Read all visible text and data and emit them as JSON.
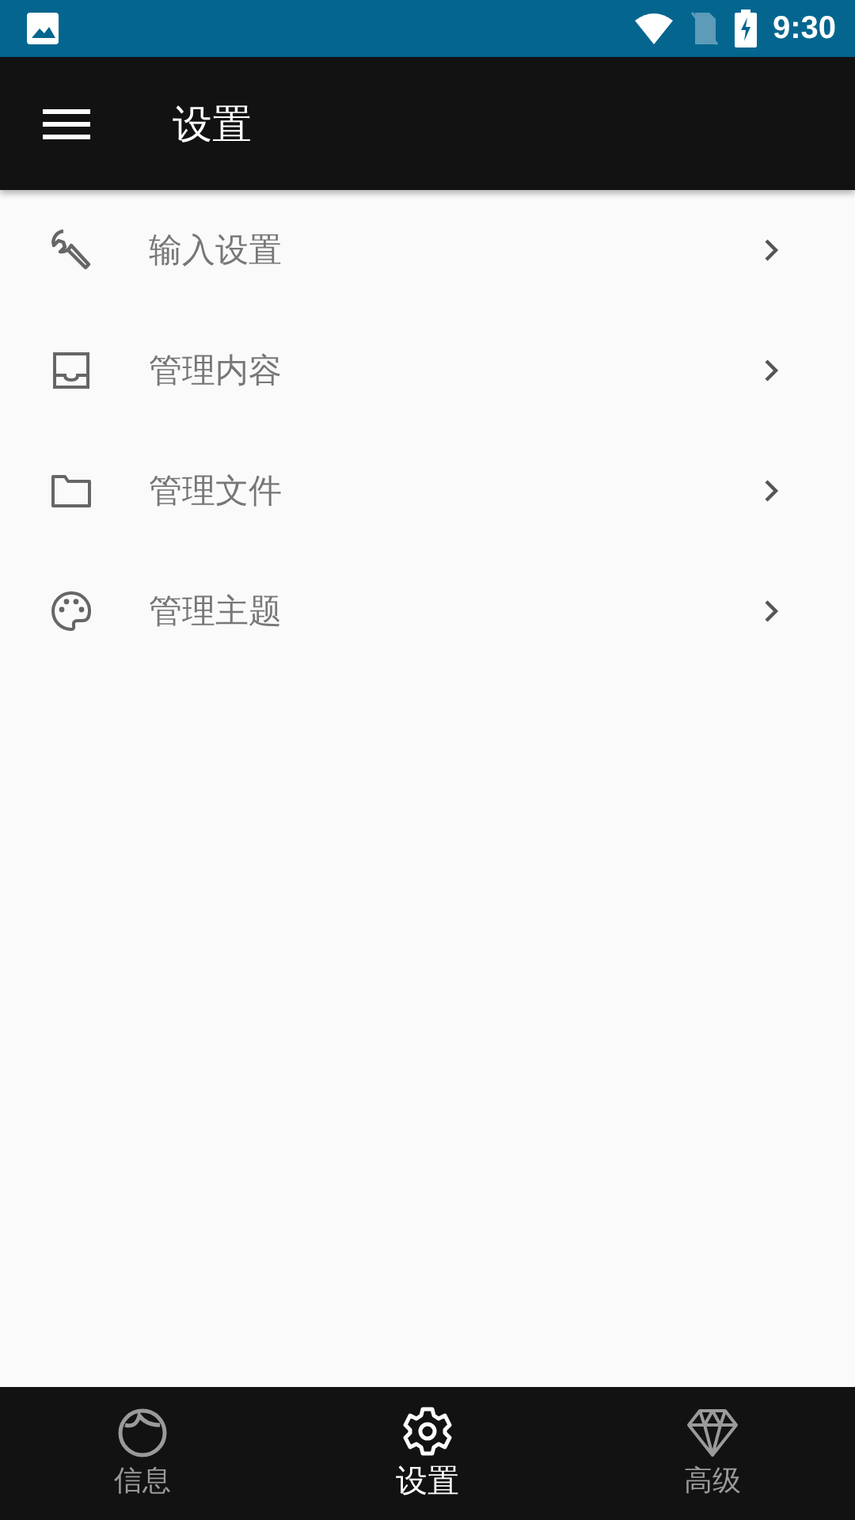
{
  "status_bar": {
    "time": "9:30"
  },
  "toolbar": {
    "title": "设置"
  },
  "menu_items": [
    {
      "label": "输入设置"
    },
    {
      "label": "管理内容"
    },
    {
      "label": "管理文件"
    },
    {
      "label": "管理主题"
    }
  ],
  "bottom_nav": [
    {
      "label": "信息",
      "selected": false
    },
    {
      "label": "设置",
      "selected": true
    },
    {
      "label": "高级",
      "selected": false
    }
  ]
}
